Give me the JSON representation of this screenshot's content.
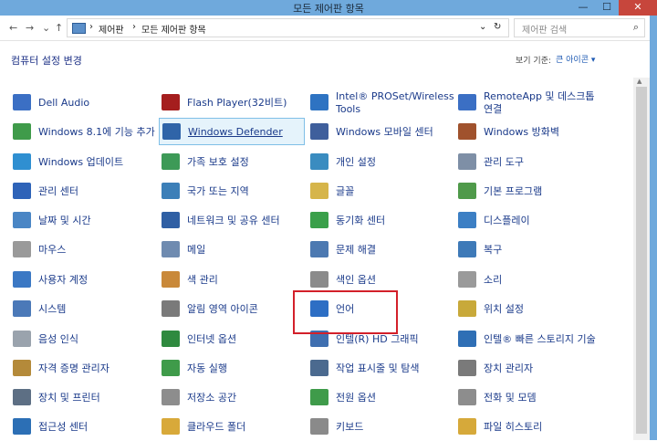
{
  "window": {
    "title": "모든 제어판 항목",
    "minimize": "—",
    "maximize": "☐",
    "close": "✕"
  },
  "toolbar": {
    "back": "←",
    "forward": "→",
    "dropdown": "⌄",
    "up": "↑",
    "crumbs": [
      "제어판",
      "모든 제어판 항목"
    ],
    "crumb_sep": "›",
    "addr_dropdown": "⌄",
    "refresh": "↻",
    "search_placeholder": "제어판 검색",
    "search_icon": "⌕"
  },
  "header": {
    "title": "컴퓨터 설정 변경",
    "view_by_label": "보기 기준:",
    "view_by_value": "큰 아이콘 ▾"
  },
  "items": [
    {
      "label": "Dell Audio",
      "color": "#3b6fc4"
    },
    {
      "label": "Windows 8.1에 기능 추가",
      "color": "#3f9b4a"
    },
    {
      "label": "Windows 업데이트",
      "color": "#2f8fd1"
    },
    {
      "label": "관리 센터",
      "color": "#2e63b8"
    },
    {
      "label": "날짜 및 시간",
      "color": "#4a86c5"
    },
    {
      "label": "마우스",
      "color": "#9a9a9a"
    },
    {
      "label": "사용자 계정",
      "color": "#3b78c4"
    },
    {
      "label": "시스템",
      "color": "#4b79b8"
    },
    {
      "label": "음성 인식",
      "color": "#9aa3ad"
    },
    {
      "label": "자격 증명 관리자",
      "color": "#b48a3a"
    },
    {
      "label": "장치 및 프린터",
      "color": "#5d6f84"
    },
    {
      "label": "접근성 센터",
      "color": "#2c6fb5"
    },
    {
      "label": "Flash Player(32비트)",
      "color": "#a51e1e"
    },
    {
      "label": "Windows Defender",
      "color": "#2f64a8"
    },
    {
      "label": "가족 보호 설정",
      "color": "#3d9a57"
    },
    {
      "label": "국가 또는 지역",
      "color": "#3c7fb8"
    },
    {
      "label": "네트워크 및 공유 센터",
      "color": "#2f5fa4"
    },
    {
      "label": "메일",
      "color": "#6f8bb0"
    },
    {
      "label": "색 관리",
      "color": "#c9893a"
    },
    {
      "label": "알림 영역 아이콘",
      "color": "#7a7a7a"
    },
    {
      "label": "인터넷 옵션",
      "color": "#2f8a3f"
    },
    {
      "label": "자동 실행",
      "color": "#3f9b4a"
    },
    {
      "label": "저장소 공간",
      "color": "#8d8d8d"
    },
    {
      "label": "클라우드 폴더",
      "color": "#d8a93a"
    },
    {
      "label": "Intel® PROSet/Wireless Tools",
      "color": "#2e73c2"
    },
    {
      "label": "Windows 모바일 센터",
      "color": "#3f5f9c"
    },
    {
      "label": "개인 설정",
      "color": "#3a8cc0"
    },
    {
      "label": "글꼴",
      "color": "#d6b54a"
    },
    {
      "label": "동기화 센터",
      "color": "#3aa04a"
    },
    {
      "label": "문제 해결",
      "color": "#4c79b1"
    },
    {
      "label": "색인 옵션",
      "color": "#8b8b8b"
    },
    {
      "label": "언어",
      "color": "#2d6ec4"
    },
    {
      "label": "인텔(R) HD 그래픽",
      "color": "#3f6fb0"
    },
    {
      "label": "작업 표시줄 및 탐색",
      "color": "#4b6a8f"
    },
    {
      "label": "전원 옵션",
      "color": "#3f9b4a"
    },
    {
      "label": "키보드",
      "color": "#8a8a8a"
    },
    {
      "label": "RemoteApp 및 데스크톱 연결",
      "color": "#3b6fc4"
    },
    {
      "label": "Windows 방화벽",
      "color": "#a0522d"
    },
    {
      "label": "관리 도구",
      "color": "#7e8fa6"
    },
    {
      "label": "기본 프로그램",
      "color": "#4f9a4a"
    },
    {
      "label": "디스플레이",
      "color": "#3c7fc4"
    },
    {
      "label": "복구",
      "color": "#3e7ab8"
    },
    {
      "label": "소리",
      "color": "#9a9a9a"
    },
    {
      "label": "위치 설정",
      "color": "#c8a93a"
    },
    {
      "label": "인텔® 빠른 스토리지 기술",
      "color": "#2f6fb5"
    },
    {
      "label": "장치 관리자",
      "color": "#7a7a7a"
    },
    {
      "label": "전화 및 모뎀",
      "color": "#8d8d8d"
    },
    {
      "label": "파일 히스토리",
      "color": "#d6a93a"
    }
  ]
}
